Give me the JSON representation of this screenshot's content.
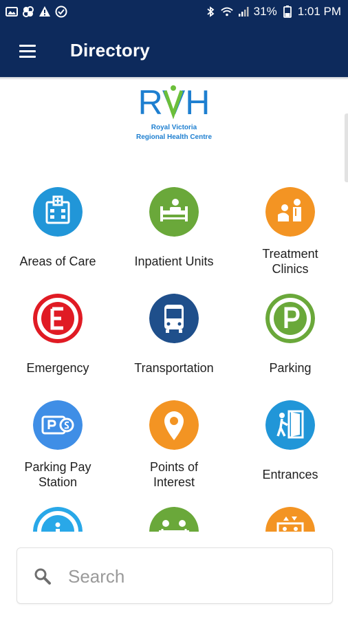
{
  "status_bar": {
    "battery_pct": "31%",
    "time": "1:01 PM",
    "left_icons": [
      "gallery-icon",
      "pinwheel-icon",
      "warning-icon",
      "check-circle-icon"
    ],
    "right_icons": [
      "bluetooth-icon",
      "wifi-icon",
      "signal-icon",
      "battery-icon"
    ]
  },
  "app_bar": {
    "title": "Directory",
    "menu_icon": "hamburger-menu-icon",
    "background": "#0d2a5c"
  },
  "logo": {
    "mark": "RVH",
    "line1": "Royal Victoria",
    "line2": "Regional Health Centre",
    "colors": {
      "letters": "#1e7fd0",
      "accent": "#6cbf3a"
    }
  },
  "tiles": [
    {
      "label": "Areas of Care",
      "icon": "hospital-building-icon",
      "color": "#2196d8"
    },
    {
      "label": "Inpatient Units",
      "icon": "patient-bed-icon",
      "color": "#6aa83a"
    },
    {
      "label": "Treatment\nClinics",
      "icon": "clinic-consultation-icon",
      "color": "#f39423"
    },
    {
      "label": "Emergency",
      "icon": "emergency-e-icon",
      "color": "#e01b24"
    },
    {
      "label": "Transportation",
      "icon": "bus-icon",
      "color": "#1f4f8b"
    },
    {
      "label": "Parking",
      "icon": "parking-p-icon",
      "color": "#6aa83a"
    },
    {
      "label": "Parking Pay\nStation",
      "icon": "parking-pay-icon",
      "color": "#3f8ee6"
    },
    {
      "label": "Points of\nInterest",
      "icon": "map-pin-icon",
      "color": "#f39423"
    },
    {
      "label": "Entrances",
      "icon": "door-entrance-icon",
      "color": "#2196d8"
    },
    {
      "label": "",
      "icon": "info-icon",
      "color": "#29a8e8"
    },
    {
      "label": "",
      "icon": "people-table-icon",
      "color": "#6aa83a"
    },
    {
      "label": "",
      "icon": "elevator-icon",
      "color": "#f39423"
    }
  ],
  "search": {
    "placeholder": "Search",
    "icon": "magnifier-icon"
  }
}
